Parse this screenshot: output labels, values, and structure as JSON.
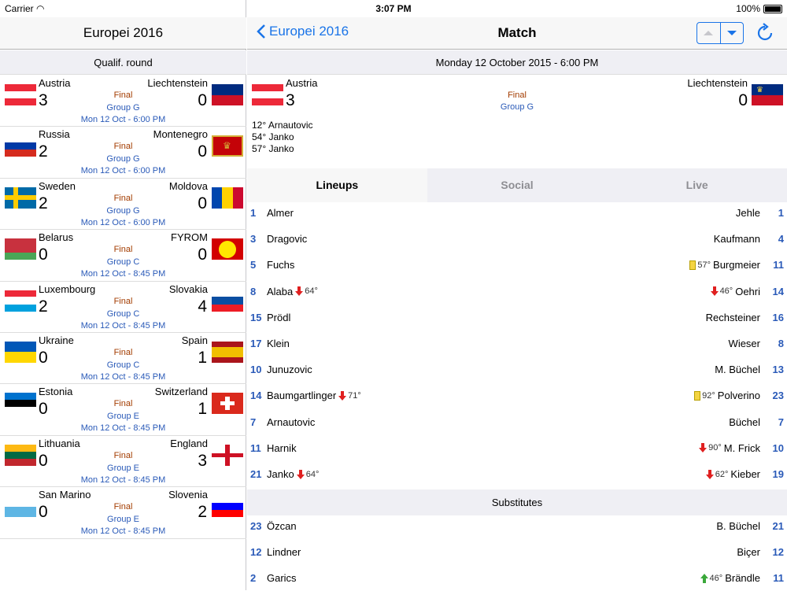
{
  "status": {
    "carrier": "Carrier",
    "time": "3:07 PM",
    "battery": "100%"
  },
  "left": {
    "title": "Europei 2016",
    "section": "Qualif. round",
    "matches": [
      {
        "home": "Austria",
        "away": "Liechtenstein",
        "hs": "3",
        "as": "0",
        "status": "Final",
        "group": "Group G",
        "date": "Mon 12 Oct - 6:00 PM"
      },
      {
        "home": "Russia",
        "away": "Montenegro",
        "hs": "2",
        "as": "0",
        "status": "Final",
        "group": "Group G",
        "date": "Mon 12 Oct - 6:00 PM"
      },
      {
        "home": "Sweden",
        "away": "Moldova",
        "hs": "2",
        "as": "0",
        "status": "Final",
        "group": "Group G",
        "date": "Mon 12 Oct - 6:00 PM"
      },
      {
        "home": "Belarus",
        "away": "FYROM",
        "hs": "0",
        "as": "0",
        "status": "Final",
        "group": "Group C",
        "date": "Mon 12 Oct - 8:45 PM"
      },
      {
        "home": "Luxembourg",
        "away": "Slovakia",
        "hs": "2",
        "as": "4",
        "status": "Final",
        "group": "Group C",
        "date": "Mon 12 Oct - 8:45 PM"
      },
      {
        "home": "Ukraine",
        "away": "Spain",
        "hs": "0",
        "as": "1",
        "status": "Final",
        "group": "Group C",
        "date": "Mon 12 Oct - 8:45 PM"
      },
      {
        "home": "Estonia",
        "away": "Switzerland",
        "hs": "0",
        "as": "1",
        "status": "Final",
        "group": "Group E",
        "date": "Mon 12 Oct - 8:45 PM"
      },
      {
        "home": "Lithuania",
        "away": "England",
        "hs": "0",
        "as": "3",
        "status": "Final",
        "group": "Group E",
        "date": "Mon 12 Oct - 8:45 PM"
      },
      {
        "home": "San Marino",
        "away": "Slovenia",
        "hs": "0",
        "as": "2",
        "status": "Final",
        "group": "Group E",
        "date": "Mon 12 Oct - 8:45 PM"
      }
    ]
  },
  "right": {
    "back_label": "Europei 2016",
    "title": "Match",
    "date_bar": "Monday 12 October 2015 - 6:00 PM",
    "match": {
      "home": "Austria",
      "away": "Liechtenstein",
      "hs": "3",
      "as": "0",
      "status": "Final",
      "group": "Group G"
    },
    "goals": [
      "12° Arnautovic",
      "54° Janko",
      "57° Janko"
    ],
    "tabs": [
      "Lineups",
      "Social",
      "Live"
    ],
    "lineups": [
      {
        "n1": "1",
        "p1": "Almer",
        "e1": "",
        "p2": "Jehle",
        "e2": "",
        "n2": "1"
      },
      {
        "n1": "3",
        "p1": "Dragovic",
        "e1": "",
        "p2": "Kaufmann",
        "e2": "",
        "n2": "4"
      },
      {
        "n1": "5",
        "p1": "Fuchs",
        "e1": "",
        "p2": "Burgmeier",
        "e2": "57°",
        "n2": "11"
      },
      {
        "n1": "8",
        "p1": "Alaba",
        "e1": "64°",
        "p2": "Oehri",
        "e2": "46°",
        "n2": "14"
      },
      {
        "n1": "15",
        "p1": "Prödl",
        "e1": "",
        "p2": "Rechsteiner",
        "e2": "",
        "n2": "16"
      },
      {
        "n1": "17",
        "p1": "Klein",
        "e1": "",
        "p2": "Wieser",
        "e2": "",
        "n2": "8"
      },
      {
        "n1": "10",
        "p1": "Junuzovic",
        "e1": "",
        "p2": "M. Büchel",
        "e2": "",
        "n2": "13"
      },
      {
        "n1": "14",
        "p1": "Baumgartlinger",
        "e1": "71°",
        "p2": "Polverino",
        "e2": "92°",
        "n2": "23"
      },
      {
        "n1": "7",
        "p1": "Arnautovic",
        "e1": "",
        "p2": "Büchel",
        "e2": "",
        "n2": "7"
      },
      {
        "n1": "11",
        "p1": "Harnik",
        "e1": "",
        "p2": "M. Frick",
        "e2": "90°",
        "n2": "10"
      },
      {
        "n1": "21",
        "p1": "Janko",
        "e1": "64°",
        "p2": "Kieber",
        "e2": "62°",
        "n2": "19"
      }
    ],
    "subs_title": "Substitutes",
    "subs": [
      {
        "n1": "23",
        "p1": "Özcan",
        "e1": "",
        "p2": "B. Büchel",
        "e2": "",
        "n2": "21"
      },
      {
        "n1": "12",
        "p1": "Lindner",
        "e1": "",
        "p2": "Biçer",
        "e2": "",
        "n2": "12"
      },
      {
        "n1": "2",
        "p1": "Garics",
        "e1": "",
        "p2": "Brändle",
        "e2": "46°",
        "n2": "11"
      }
    ]
  },
  "colors": {
    "accent": "#1a74e8",
    "status": "#a33c00",
    "link": "#2a5ab8"
  }
}
